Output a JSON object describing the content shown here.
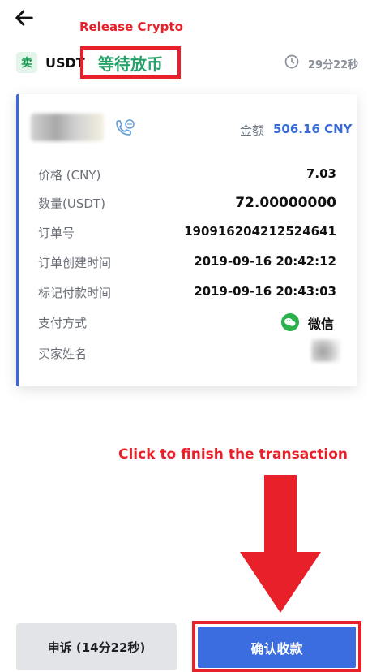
{
  "annotations": {
    "release": "Release Crypto",
    "click": "Click to finish the transaction"
  },
  "header": {
    "side_badge": "卖",
    "asset": "USDT",
    "status": "等待放币",
    "countdown": "29分22秒"
  },
  "card": {
    "amount_label": "金额",
    "amount_value": "506.16 CNY",
    "rows": [
      {
        "label": "价格 (CNY)",
        "value": "7.03"
      },
      {
        "label": "数量(USDT)",
        "value": "72.00000000"
      },
      {
        "label": "订单号",
        "value": "190916204212524641"
      },
      {
        "label": "订单创建时间",
        "value": "2019-09-16 20:42:12"
      },
      {
        "label": "标记付款时间",
        "value": "2019-09-16 20:43:03"
      },
      {
        "label": "支付方式",
        "value": "微信"
      },
      {
        "label": "买家姓名",
        "value": ""
      }
    ]
  },
  "actions": {
    "appeal": "申诉 (14分22秒)",
    "confirm": "确认收款"
  },
  "colors": {
    "status_green": "#25a26a",
    "accent_blue": "#3b6de0",
    "annotation_red": "#e8202a",
    "wechat_green": "#2bb24c"
  }
}
